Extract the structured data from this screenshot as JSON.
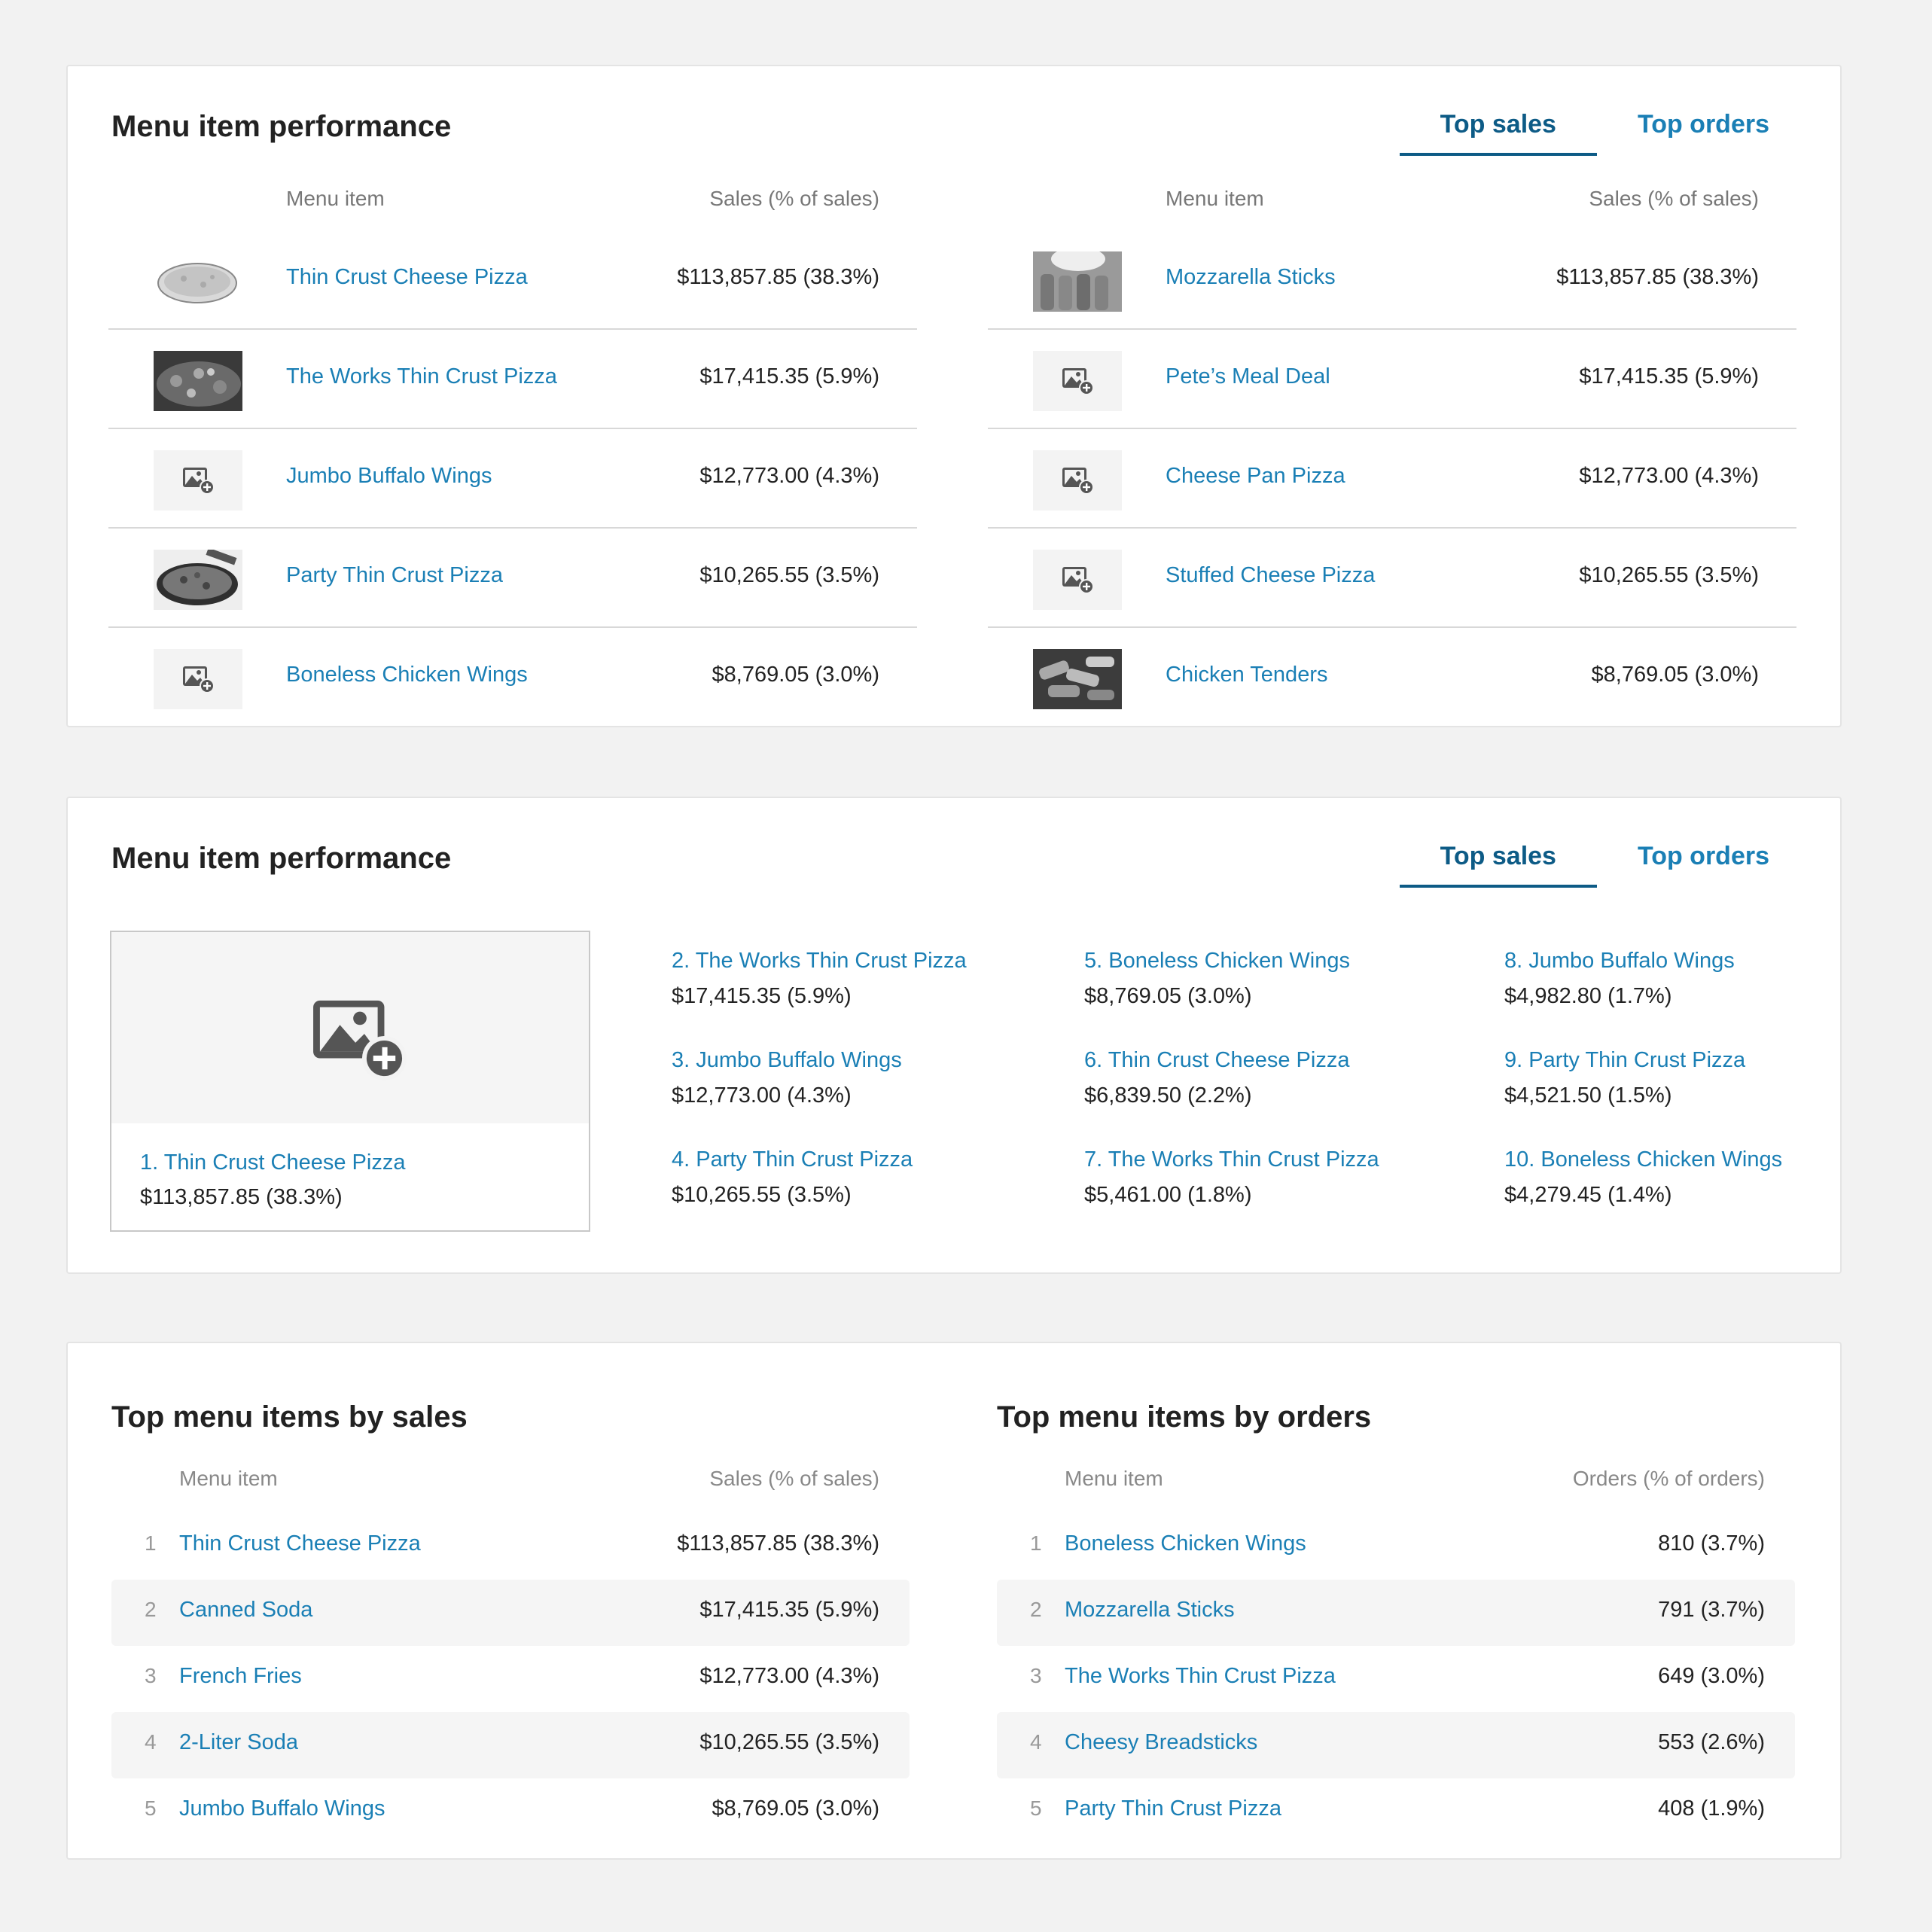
{
  "colors": {
    "link": "#1a7fb5",
    "active_tab": "#0d5b86",
    "text": "#222222",
    "muted": "#777777",
    "background": "#f2f2f2"
  },
  "card1": {
    "title": "Menu item performance",
    "tabs": {
      "active": "Top sales",
      "other": "Top orders"
    },
    "left_table": {
      "col_item": "Menu item",
      "col_sales": "Sales (% of sales)",
      "rows": [
        {
          "name": "Thin Crust Cheese Pizza",
          "value": "$113,857.85 (38.3%)",
          "image": "pizza-photo"
        },
        {
          "name": "The Works Thin Crust Pizza",
          "value": "$17,415.35 (5.9%)",
          "image": "pizza-photo"
        },
        {
          "name": "Jumbo Buffalo Wings",
          "value": "$12,773.00 (4.3%)",
          "image": "add-image-icon"
        },
        {
          "name": "Party Thin Crust Pizza",
          "value": "$10,265.55 (3.5%)",
          "image": "pizza-photo"
        },
        {
          "name": "Boneless Chicken Wings",
          "value": "$8,769.05 (3.0%)",
          "image": "add-image-icon"
        }
      ]
    },
    "right_table": {
      "col_item": "Menu item",
      "col_sales": "Sales (% of sales)",
      "rows": [
        {
          "name": "Mozzarella Sticks",
          "value": "$113,857.85 (38.3%)",
          "image": "mozzarella-photo"
        },
        {
          "name": "Pete’s Meal Deal",
          "value": "$17,415.35 (5.9%)",
          "image": "add-image-icon"
        },
        {
          "name": "Cheese Pan Pizza",
          "value": "$12,773.00 (4.3%)",
          "image": "add-image-icon"
        },
        {
          "name": "Stuffed Cheese Pizza",
          "value": "$10,265.55 (3.5%)",
          "image": "add-image-icon"
        },
        {
          "name": "Chicken Tenders",
          "value": "$8,769.05 (3.0%)",
          "image": "tenders-photo"
        }
      ]
    }
  },
  "card2": {
    "title": "Menu item performance",
    "tabs": {
      "active": "Top sales",
      "other": "Top orders"
    },
    "featured": {
      "name": "1. Thin Crust Cheese Pizza",
      "value": "$113,857.85 (38.3%)"
    },
    "items": [
      {
        "name": "2. The Works Thin Crust Pizza",
        "value": "$17,415.35 (5.9%)"
      },
      {
        "name": "3. Jumbo Buffalo Wings",
        "value": "$12,773.00 (4.3%)"
      },
      {
        "name": "4. Party Thin Crust Pizza",
        "value": "$10,265.55 (3.5%)"
      },
      {
        "name": "5. Boneless Chicken Wings",
        "value": "$8,769.05 (3.0%)"
      },
      {
        "name": "6. Thin Crust Cheese Pizza",
        "value": "$6,839.50 (2.2%)"
      },
      {
        "name": "7. The Works Thin Crust Pizza",
        "value": "$5,461.00 (1.8%)"
      },
      {
        "name": "8. Jumbo Buffalo Wings",
        "value": "$4,982.80 (1.7%)"
      },
      {
        "name": "9. Party Thin Crust Pizza",
        "value": "$4,521.50 (1.5%)"
      },
      {
        "name": "10. Boneless Chicken Wings",
        "value": "$4,279.45 (1.4%)"
      }
    ]
  },
  "card3": {
    "sales": {
      "title": "Top menu items by sales",
      "col_item": "Menu item",
      "col_value": "Sales (% of sales)",
      "rows": [
        {
          "rank": "1",
          "name": "Thin Crust Cheese Pizza",
          "value": "$113,857.85 (38.3%)"
        },
        {
          "rank": "2",
          "name": "Canned Soda",
          "value": "$17,415.35 (5.9%)"
        },
        {
          "rank": "3",
          "name": "French Fries",
          "value": "$12,773.00 (4.3%)"
        },
        {
          "rank": "4",
          "name": "2-Liter Soda",
          "value": "$10,265.55 (3.5%)"
        },
        {
          "rank": "5",
          "name": "Jumbo Buffalo Wings",
          "value": "$8,769.05 (3.0%)"
        }
      ]
    },
    "orders": {
      "title": "Top menu items by orders",
      "col_item": "Menu item",
      "col_value": "Orders (% of orders)",
      "rows": [
        {
          "rank": "1",
          "name": "Boneless Chicken Wings",
          "value": "810 (3.7%)"
        },
        {
          "rank": "2",
          "name": "Mozzarella Sticks",
          "value": "791 (3.7%)"
        },
        {
          "rank": "3",
          "name": "The Works Thin Crust Pizza",
          "value": "649 (3.0%)"
        },
        {
          "rank": "4",
          "name": "Cheesy Breadsticks",
          "value": "553 (2.6%)"
        },
        {
          "rank": "5",
          "name": "Party Thin Crust Pizza",
          "value": "408 (1.9%)"
        }
      ]
    }
  }
}
